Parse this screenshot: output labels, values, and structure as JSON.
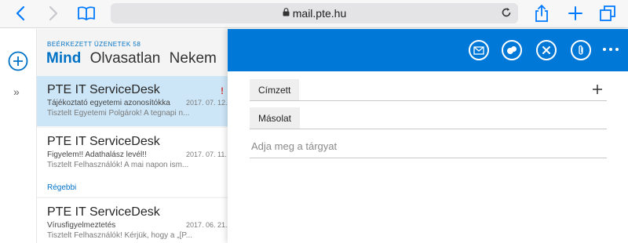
{
  "browser": {
    "url": "mail.pte.hu",
    "icons": {
      "back": "chevron-left-icon",
      "forward": "chevron-right-icon",
      "bookmarks": "book-icon",
      "lock": "lock-icon",
      "reload": "reload-icon",
      "share": "share-icon",
      "new_tab": "plus-icon",
      "tabs": "tabs-icon"
    },
    "accent_color": "#007aff"
  },
  "rail": {
    "icons": {
      "new": "add-circle-icon",
      "expand": "double-chevron-right-icon"
    },
    "expand_label": "»"
  },
  "list": {
    "folder_label": "BEÉRKEZETT ÜZENETEK 58",
    "filters": [
      "Mind",
      "Olvasatlan",
      "Nekem"
    ],
    "active_filter": "Mind",
    "section_older": "Régebbi",
    "items": [
      {
        "sender": "PTE IT ServiceDesk",
        "subject": "Tájékoztató egyetemi azonosítókka",
        "date": "2017. 07. 12.",
        "preview": "Tisztelt Egyetemi Polgárok!  A tegnapi n...",
        "flag": "!",
        "selected": true
      },
      {
        "sender": "PTE IT ServiceDesk",
        "subject": "Figyelem!! Adathalász levél!!",
        "date": "2017. 07. 11.",
        "preview": "Tisztelt Felhasználók!  A mai napon ism...",
        "flag": "",
        "selected": false
      },
      {
        "sender": "PTE IT ServiceDesk",
        "subject": "Vírusfigyelmeztetés",
        "date": "2017. 06. 21.",
        "preview": "Tisztelt Felhasználók!  Kérjük, hogy a „[P...",
        "flag": "",
        "selected": false
      }
    ]
  },
  "compose": {
    "bar_color": "#0078d7",
    "toolbar_icons": [
      "envelope-icon",
      "chat-bubbles-icon",
      "close-icon",
      "attachment-icon",
      "more-icon"
    ],
    "to_label": "Címzett",
    "cc_label": "Másolat",
    "add_recipient": "+",
    "subject_placeholder": "Adja meg a tárgyat",
    "subject_value": ""
  }
}
